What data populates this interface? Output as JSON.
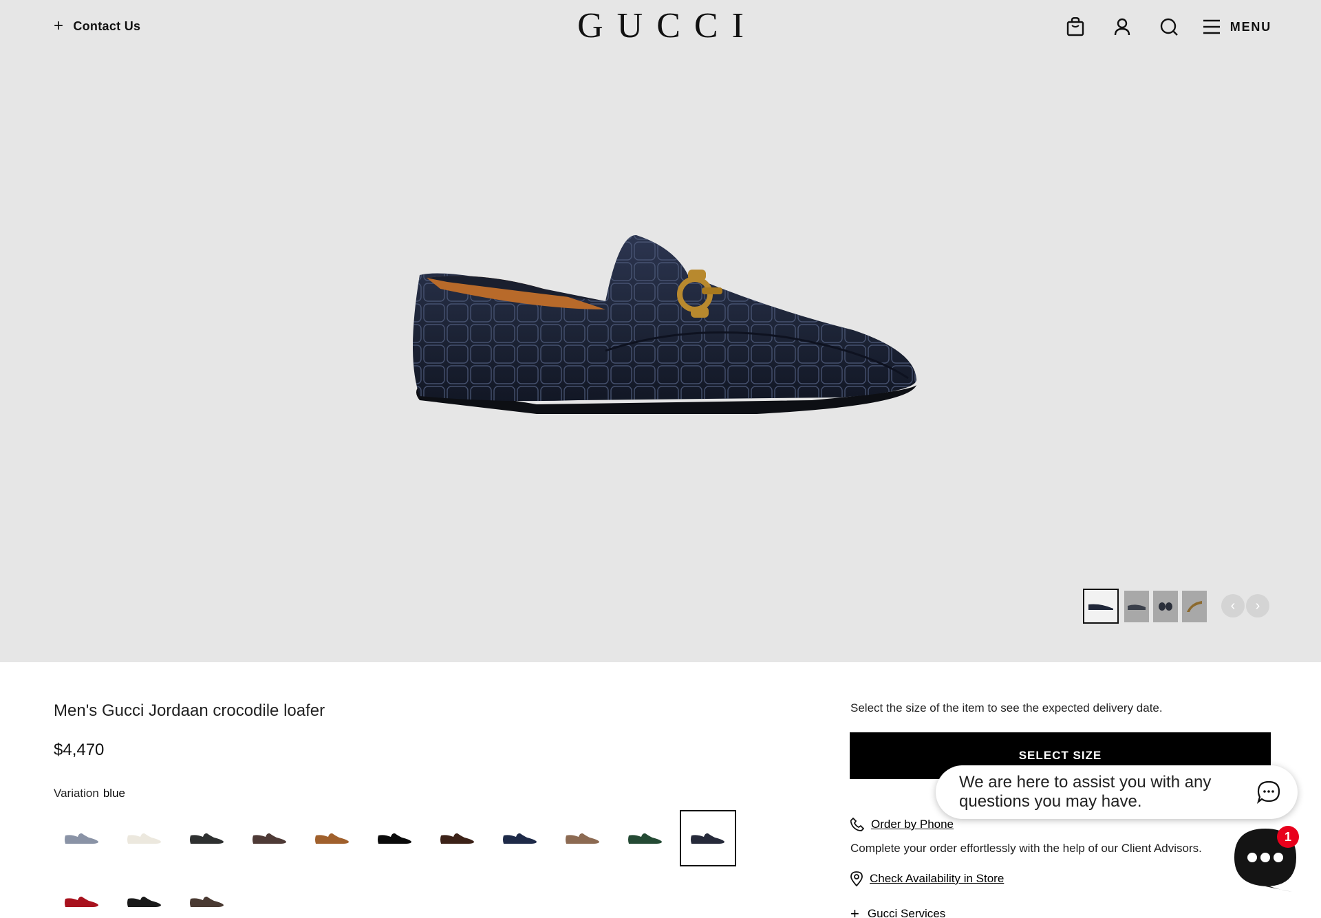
{
  "header": {
    "contact_label": "Contact Us",
    "logo": "GUCCI",
    "menu_label": "MENU"
  },
  "gallery": {
    "thumbnail_count": 4,
    "active_thumbnail": 1
  },
  "product": {
    "name": "Men's Gucci Jordaan crocodile loafer",
    "price": "$4,470",
    "variation_label": "Variation",
    "variation_value": "blue",
    "swatches": [
      {
        "color": "#8a93a6"
      },
      {
        "color": "#ece8de"
      },
      {
        "color": "#2e3030"
      },
      {
        "color": "#4e3a36"
      },
      {
        "color": "#a0602c"
      },
      {
        "color": "#0a0a0a"
      },
      {
        "color": "#3c2218"
      },
      {
        "color": "#1e2a48"
      },
      {
        "color": "#8c6a52"
      },
      {
        "color": "#244a34"
      },
      {
        "color": "#262a3a",
        "selected": true
      },
      {
        "color": "#a8121e"
      },
      {
        "color": "#1a1a1a"
      },
      {
        "color": "#4a3a32"
      }
    ]
  },
  "purchase": {
    "delivery_note": "Select the size of the item to see the expected delivery date.",
    "select_size_label": "SELECT SIZE",
    "order_by_phone": "Order by Phone",
    "complete_note": "Complete your order effortlessly with the help of our Client Advisors.",
    "check_store": "Check Availability in Store",
    "services": "Gucci Services"
  },
  "chat": {
    "message": "We are here to assist you with any questions you may have.",
    "badge_count": "1"
  },
  "colors": {
    "hero_bg": "#e6e6e6",
    "shoe_leather": "#1f2638",
    "horsebit_gold": "#b8892e",
    "badge_red": "#e8001c"
  }
}
